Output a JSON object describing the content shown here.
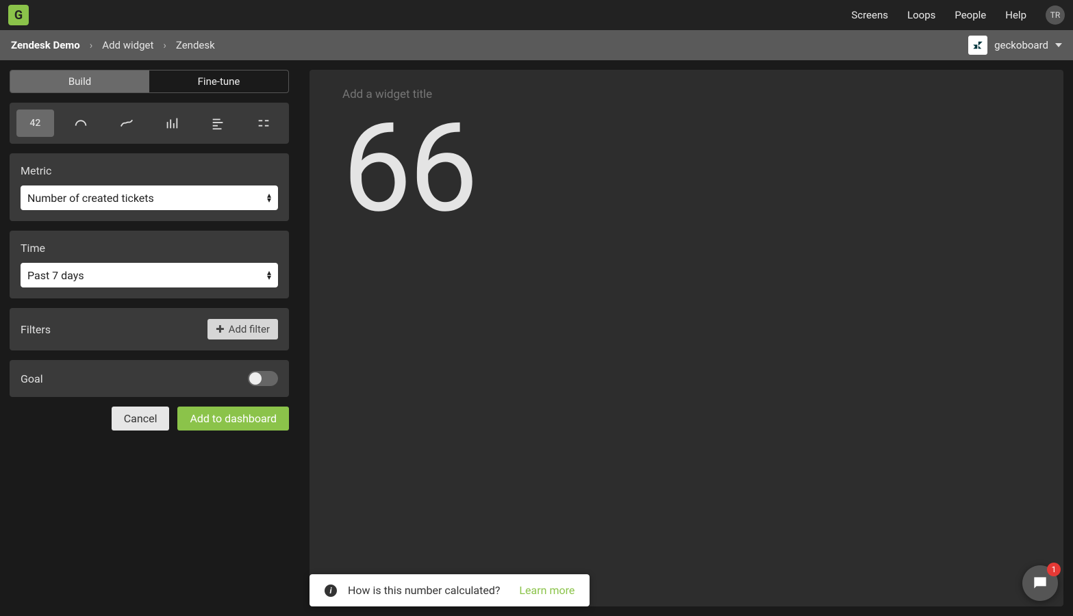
{
  "header": {
    "logo_letter": "G",
    "nav": [
      "Screens",
      "Loops",
      "People",
      "Help"
    ],
    "avatar_initials": "TR"
  },
  "breadcrumb": {
    "items": [
      "Zendesk Demo",
      "Add widget",
      "Zendesk"
    ],
    "account_name": "geckoboard"
  },
  "tabs": {
    "build": "Build",
    "finetune": "Fine-tune"
  },
  "viz": {
    "number_label": "42"
  },
  "metric": {
    "label": "Metric",
    "value": "Number of created tickets"
  },
  "time": {
    "label": "Time",
    "value": "Past 7 days"
  },
  "filters": {
    "label": "Filters",
    "add_label": "Add filter"
  },
  "goal": {
    "label": "Goal"
  },
  "actions": {
    "cancel": "Cancel",
    "add": "Add to dashboard"
  },
  "preview": {
    "title_placeholder": "Add a widget title",
    "big_number": "66"
  },
  "callout": {
    "text": "How is this number calculated?",
    "link": "Learn more"
  },
  "chat": {
    "badge": "1"
  }
}
